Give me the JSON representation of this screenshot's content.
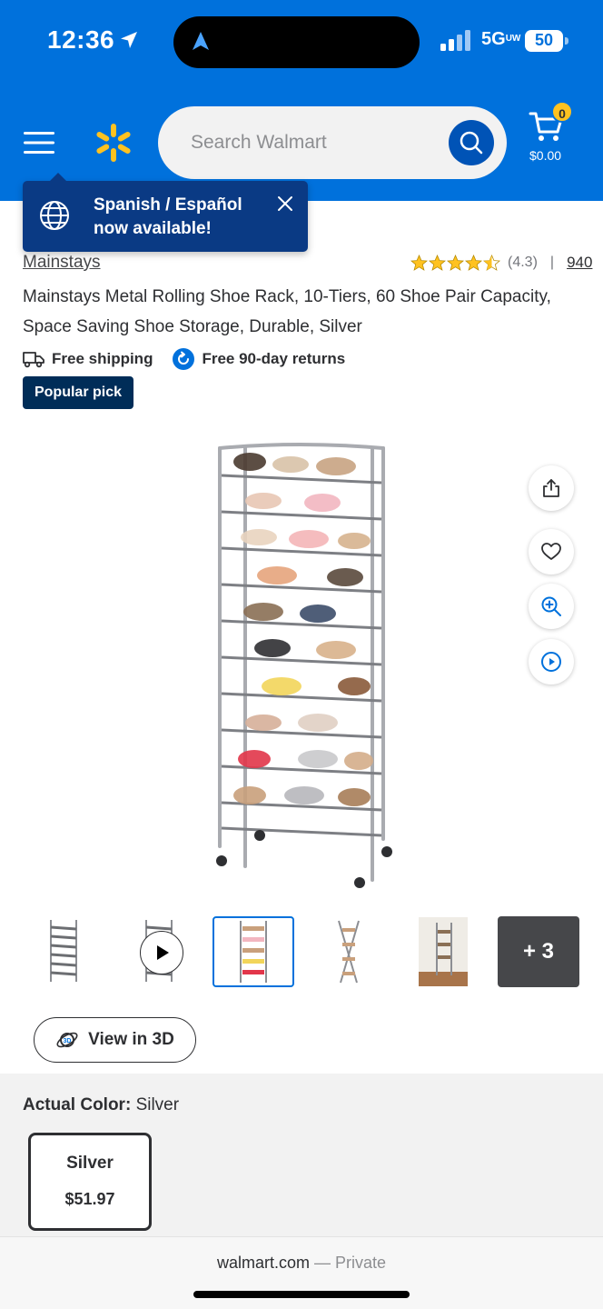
{
  "status_bar": {
    "time": "12:36",
    "network": "5G",
    "network_suffix": "UW",
    "battery": "50"
  },
  "header": {
    "search_placeholder": "Search Walmart",
    "cart_count": "0",
    "cart_total": "$0.00",
    "brand_color": "#0071dc",
    "accent_color": "#ffc220"
  },
  "tooltip": {
    "line1": "Spanish / Español",
    "line2": "now available!"
  },
  "product": {
    "brand": "Mainstays",
    "rating": "(4.3)",
    "rating_value": 4.3,
    "rating_separator": "|",
    "review_count": "940",
    "title": "Mainstays Metal Rolling Shoe Rack, 10-Tiers, 60 Shoe Pair Capacity, Space Saving Shoe Storage, Durable, Silver",
    "free_shipping": "Free shipping",
    "free_returns": "Free 90-day returns",
    "badge": "Popular pick"
  },
  "side_actions": [
    "share-icon",
    "heart-icon",
    "zoom-in-icon",
    "play-icon"
  ],
  "thumbnails": {
    "more_label": "+ 3",
    "selected_index": 2
  },
  "view_3d_label": "View in 3D",
  "variant": {
    "label_prefix": "Actual Color:",
    "label_value": "Silver",
    "option_name": "Silver",
    "option_price": "$51.97"
  },
  "browser": {
    "domain": "walmart.com",
    "separator": "—",
    "mode": "Private"
  }
}
